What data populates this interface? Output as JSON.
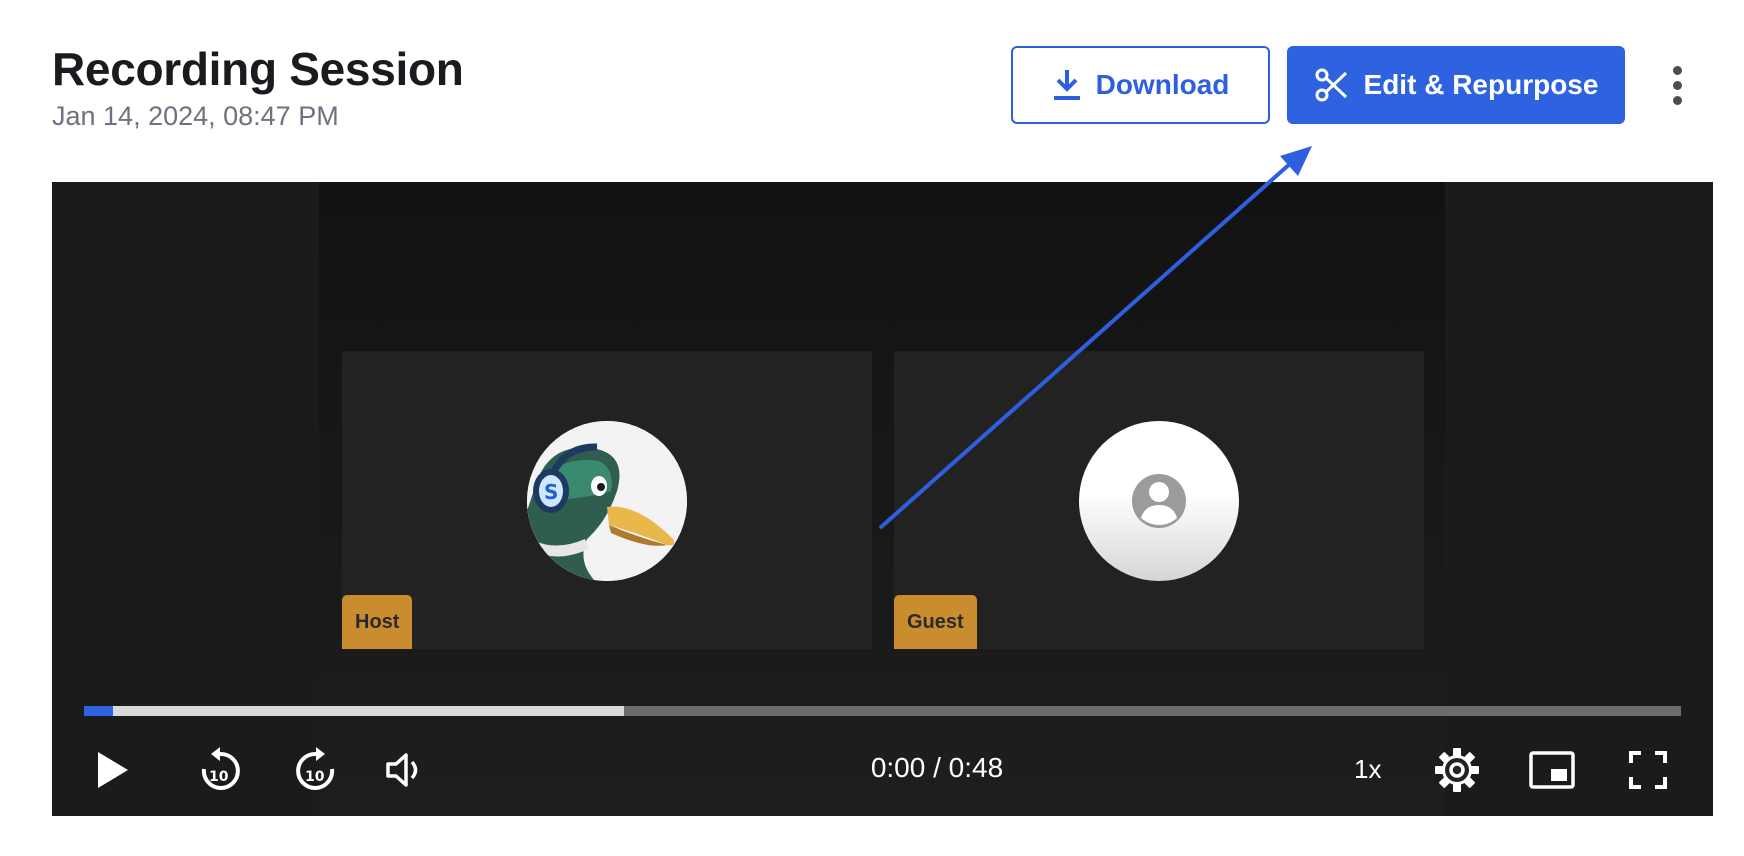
{
  "header": {
    "title": "Recording Session",
    "date": "Jan 14, 2024, 08:47 PM"
  },
  "actions": {
    "download_label": "Download",
    "edit_label": "Edit & Repurpose"
  },
  "participants": [
    {
      "role": "Host",
      "avatar": "duck-headphones-logo"
    },
    {
      "role": "Guest",
      "avatar": "default-user-icon"
    }
  ],
  "player": {
    "current_time": "0:00",
    "separator": "/",
    "duration": "0:48",
    "playback_rate": "1x",
    "played_fraction": 0.018,
    "buffered_fraction": 0.338
  },
  "colors": {
    "accent": "#2e62e0",
    "tag": "#c98d30",
    "annotation_arrow": "#2e5fe0"
  },
  "icons": [
    "download-icon",
    "scissors-icon",
    "more-vertical-icon",
    "play-icon",
    "rewind-10-icon",
    "forward-10-icon",
    "volume-icon",
    "settings-gear-icon",
    "picture-in-picture-icon",
    "fullscreen-icon"
  ]
}
